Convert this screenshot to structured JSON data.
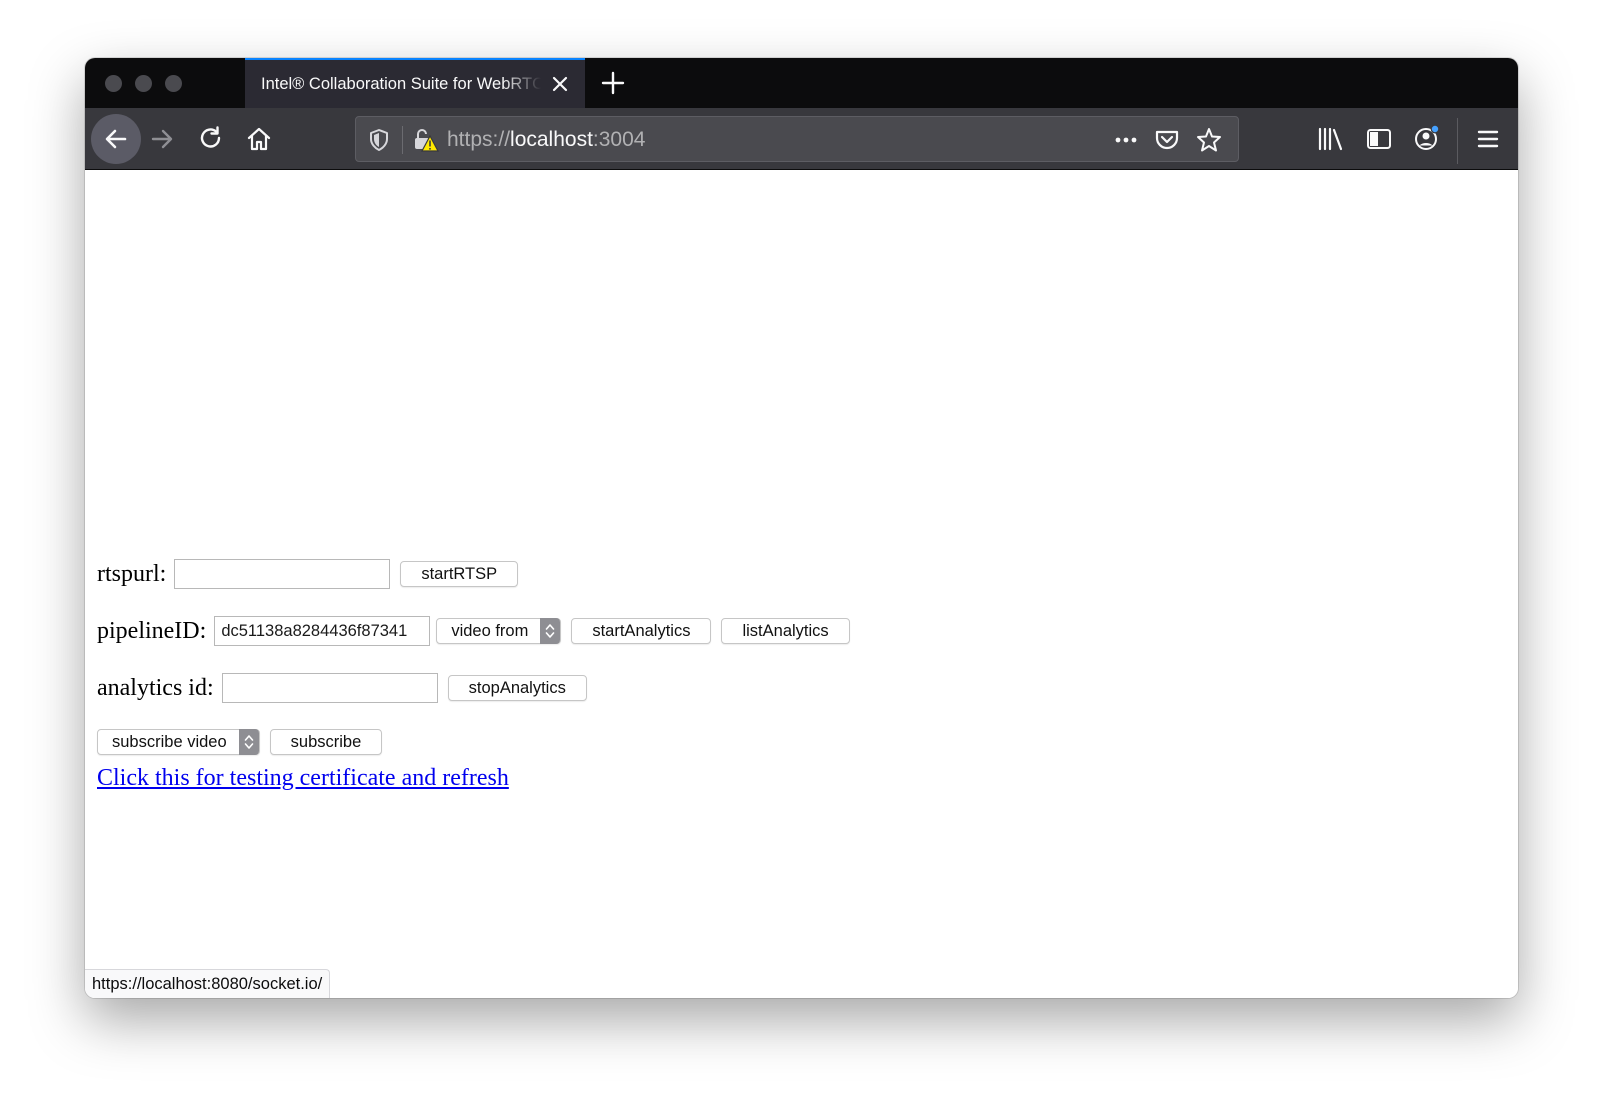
{
  "browser": {
    "tab": {
      "title": "Intel® Collaboration Suite for WebRTC"
    },
    "url": {
      "scheme": "https://",
      "host": "localhost",
      "port": ":3004"
    },
    "accent_color": "#0a84ff",
    "icons": {
      "traffic_lights": [
        "close-window",
        "minimize-window",
        "zoom-window"
      ],
      "tab_close": "close-icon",
      "new_tab": "plus-icon",
      "nav": [
        "back-arrow-icon",
        "forward-arrow-icon",
        "reload-icon",
        "home-icon"
      ],
      "urlbar": [
        "tracking-shield-icon",
        "insecure-lock-warning-icon",
        "page-actions-ellipsis-icon",
        "pocket-icon",
        "bookmark-star-icon"
      ],
      "toolbar": [
        "library-icon",
        "sidebar-icon",
        "account-icon",
        "hamburger-menu-icon"
      ]
    }
  },
  "form": {
    "rtsp_label": "rtspurl:",
    "rtsp_value": "",
    "start_rtsp_label": "startRTSP",
    "pipeline_label": "pipelineID:",
    "pipeline_value": "dc51138a8284436f87341",
    "video_from_selected": "video from",
    "start_analytics_label": "startAnalytics",
    "list_analytics_label": "listAnalytics",
    "analytics_id_label": "analytics id:",
    "analytics_id_value": "",
    "stop_analytics_label": "stopAnalytics",
    "subscribe_video_selected": "subscribe video",
    "subscribe_label": "subscribe",
    "cert_link_text": "Click this for testing certificate and refresh",
    "link_color": "#0000ee"
  },
  "status": {
    "url": "https://localhost:8080/socket.io/"
  }
}
